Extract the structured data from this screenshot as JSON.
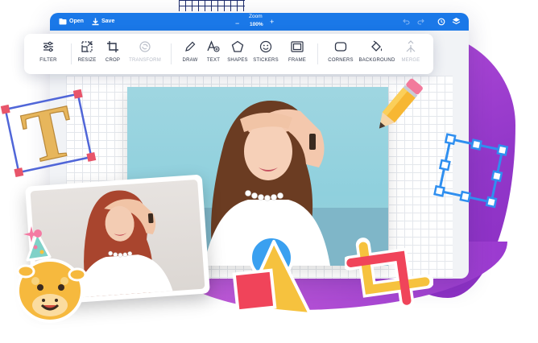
{
  "topbar": {
    "open_label": "Open",
    "save_label": "Save",
    "zoom_label": "Zoom",
    "zoom_value": "100%",
    "zoom_minus": "−",
    "zoom_plus": "+"
  },
  "toolbar": {
    "tools": [
      {
        "label": "FILTER",
        "icon": "sliders-icon",
        "enabled": true
      },
      {
        "label": "RESIZE",
        "icon": "resize-icon",
        "enabled": true
      },
      {
        "label": "CROP",
        "icon": "crop-icon",
        "enabled": true
      },
      {
        "label": "TRANSFORM",
        "icon": "transform-icon",
        "enabled": false
      },
      {
        "label": "DRAW",
        "icon": "pencil-icon",
        "enabled": true
      },
      {
        "label": "TEXT",
        "icon": "text-icon",
        "enabled": true
      },
      {
        "label": "SHAPES",
        "icon": "pentagon-icon",
        "enabled": true
      },
      {
        "label": "STICKERS",
        "icon": "smiley-icon",
        "enabled": true
      },
      {
        "label": "FRAME",
        "icon": "frame-icon",
        "enabled": true
      },
      {
        "label": "CORNERS",
        "icon": "rounded-rect-icon",
        "enabled": true
      },
      {
        "label": "BACKGROUND",
        "icon": "paint-bucket-icon",
        "enabled": true
      },
      {
        "label": "MERGE",
        "icon": "merge-icon",
        "enabled": false
      }
    ]
  },
  "colors": {
    "accent": "#1a78e8",
    "purple": "#9a3ad0",
    "sticker_blue": "#3aa0f0",
    "sticker_yellow": "#f6c23e",
    "sticker_red": "#f0445a"
  }
}
